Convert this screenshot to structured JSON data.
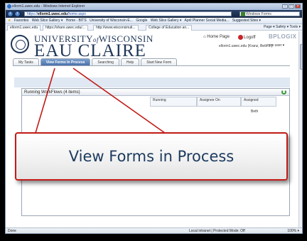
{
  "window": {
    "title": "ellorm1.uwec.edu - Windows Internet Explorer"
  },
  "address_bar": {
    "url_prefix": "https://",
    "url_host": "ellorm1.uwec.edu",
    "url_path": "/home.aspx",
    "search_placeholder": "Windows Forms"
  },
  "favorites_bar": {
    "items": [
      "Favorites",
      "Web Slice Gallery ▾",
      "Home - BITS",
      "University of Wisconsin-E...",
      "Google",
      "Web Slice Gallery ▾",
      "April Planner Social Media...",
      "Suggested Sites ▾"
    ]
  },
  "browser_tabs": {
    "items": [
      "ellorm1.uwec.edu",
      "https://share.uwec.edu/...",
      "http://www.wisconsinuti...",
      "College of Education an..."
    ],
    "tools": "Page ▾  Safety ▾  Tools ▾"
  },
  "header": {
    "logo_line1": "UNIVERSITY",
    "logo_of": "of",
    "logo_line1b": "WISCONSIN",
    "logo_line2": "EAU CLAIRE",
    "home_page": "Home Page",
    "logoff": "Logoff",
    "brand": "BPLOGIX",
    "user_line": "ellorm1.uwec.edu (Kranz, Beth L.)",
    "new_user": "new user ▾"
  },
  "nav_tabs": [
    "My Tasks",
    "View Forms In Process",
    "Searching",
    "Help",
    "Start New Form"
  ],
  "panel": {
    "title": "Running WorkFlows (4 items)",
    "col_running": "Running",
    "col_assignee_on": "Assignee On",
    "col_assigned": "Assigned",
    "peek": "Beth"
  },
  "status_bar": {
    "done": "Done",
    "zone": "Local intranet | Protected Mode: Off",
    "zoom": "100% ▾"
  },
  "callout": {
    "text": "View Forms in Process"
  },
  "colors": {
    "callout_border": "#c11b17",
    "callout_text": "#1c3a5e",
    "active_tab": "#4b72ab"
  }
}
